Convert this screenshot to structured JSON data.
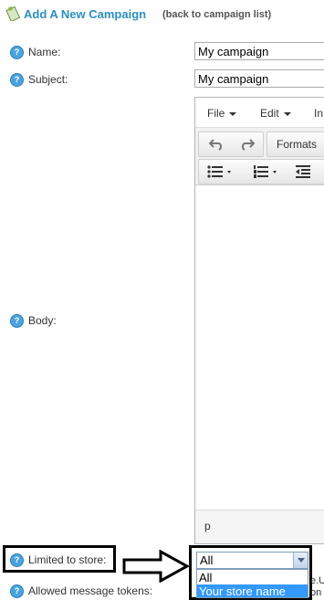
{
  "header": {
    "title": "Add A New Campaign",
    "back_link": "(back to campaign list)"
  },
  "fields": {
    "name": {
      "label": "Name:",
      "value": "My campaign"
    },
    "subject": {
      "label": "Subject:",
      "value": "My campaign"
    },
    "body": {
      "label": "Body:"
    },
    "store": {
      "label": "Limited to store:",
      "selected": "All",
      "options": [
        "All",
        "Your store name"
      ]
    },
    "tokens": {
      "label": "Allowed message tokens:",
      "partial_text": "e.U\non"
    }
  },
  "editor": {
    "menu": [
      "File",
      "Edit",
      "In"
    ],
    "formats_label": "Formats",
    "statusbar_path": "p"
  },
  "colors": {
    "title": "#2b8fc4",
    "help_icon": "#4aa3df",
    "selected_option": "#3399ff"
  },
  "icons": [
    "campaign-icon",
    "help-icon",
    "undo-icon",
    "redo-icon",
    "bullet-list-icon",
    "numbered-list-icon",
    "outdent-icon",
    "arrow-right-icon"
  ]
}
